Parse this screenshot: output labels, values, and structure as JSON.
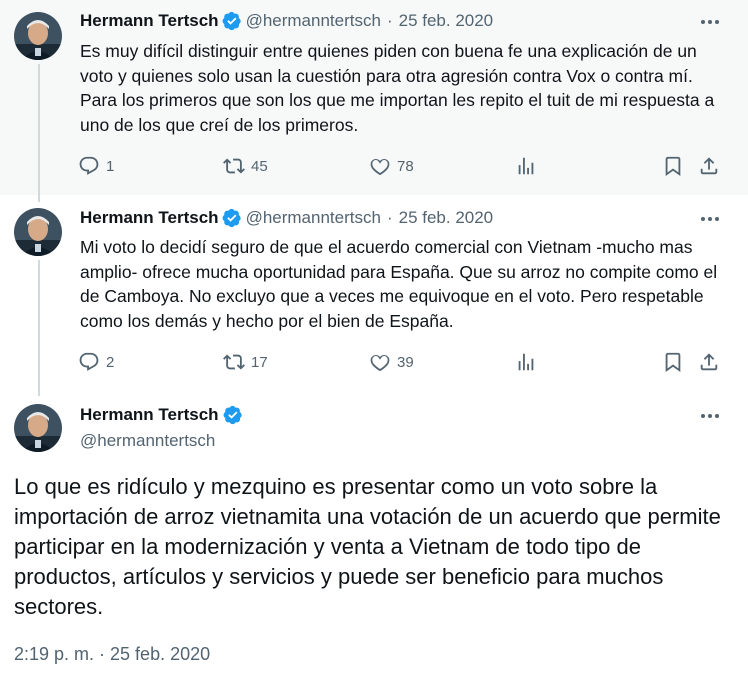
{
  "tweets": [
    {
      "name": "Hermann Tertsch",
      "handle": "@hermanntertsch",
      "separator": "·",
      "date": "25 feb. 2020",
      "text": "Es muy difícil distinguir entre quienes piden con buena fe una explicación de un voto y quienes solo usan la cuestión para otra agresión contra Vox o contra mí. Para los primeros que son los que me importan les repito el tuit de mi respuesta a uno de los que creí de los primeros.",
      "replies": "1",
      "retweets": "45",
      "likes": "78"
    },
    {
      "name": "Hermann Tertsch",
      "handle": "@hermanntertsch",
      "separator": "·",
      "date": "25 feb. 2020",
      "text": "Mi voto lo decidí seguro de que el acuerdo comercial con Vietnam -mucho mas amplio- ofrece mucha oportunidad para España. Que su arroz no compite como el de Camboya. No excluyo que a veces me equivoque en el voto. Pero respetable como los demás y hecho por el bien de España.",
      "replies": "2",
      "retweets": "17",
      "likes": "39"
    }
  ],
  "main_tweet": {
    "name": "Hermann Tertsch",
    "handle": "@hermanntertsch",
    "text": "Lo que es ridículo y mezquino es presentar como un voto sobre la importación de arroz vietnamita una votación de un acuerdo que permite participar en la modernización y venta a Vietnam de todo tipo de productos, artículos y servicios y puede ser beneficio para muchos sectores.",
    "timestamp": "2:19 p. m. · 25 feb. 2020"
  },
  "icons": [
    "verified-badge-icon",
    "more-icon",
    "reply-icon",
    "retweet-icon",
    "like-icon",
    "views-icon",
    "bookmark-icon",
    "share-icon"
  ],
  "colors": {
    "text": "#0f1419",
    "secondary": "#536471",
    "verified": "#1d9bf0",
    "thread_line": "#cfd9de",
    "highlight_bg": "#f7f9f9"
  }
}
